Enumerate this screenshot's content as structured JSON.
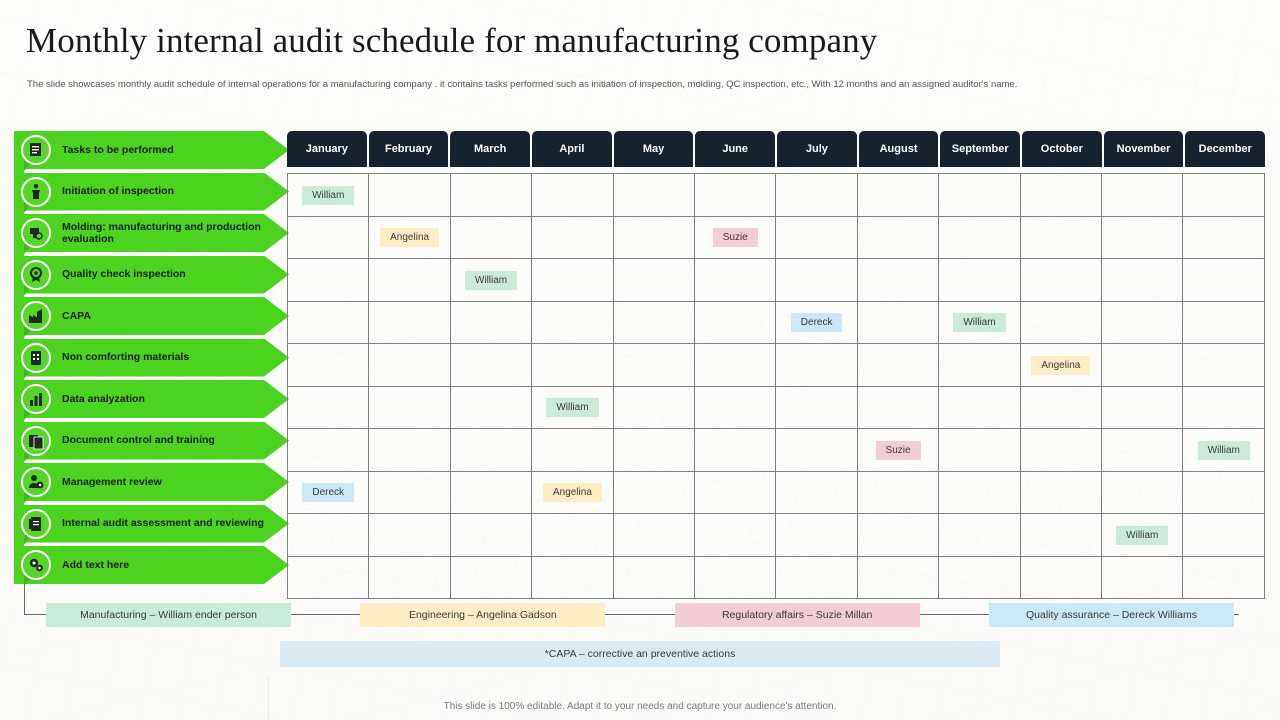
{
  "slide": {
    "title": "Monthly internal audit schedule for manufacturing company",
    "subtitle": "The slide showcases monthly audit schedule of internal operations  for a manufacturing company . it contains tasks performed such as initiation  of inspection, molding,  QC  inspection, etc., With 12 months and an assigned auditor's name.",
    "footnote": "*CAPA – corrective an preventive actions",
    "bottom_note": "This slide is 100% editable.  Adapt it to your needs and capture your audience's attention."
  },
  "colors": {
    "green_arrow": "#4cd320",
    "header_navy": "#16232e",
    "chip_green": "#c9ebd8",
    "chip_cream": "#fdeec6",
    "chip_pink": "#f2cdd3",
    "chip_blue": "#cce8f5",
    "footnote_bar": "#dbeaf2"
  },
  "tasks": [
    {
      "label": "Tasks to be performed",
      "icon": "document-lines-icon"
    },
    {
      "label": "Initiation  of inspection",
      "icon": "presenter-podium-icon"
    },
    {
      "label": "Molding:  manufacturing and production  evaluation",
      "icon": "stamp-press-icon"
    },
    {
      "label": "Quality  check inspection",
      "icon": "quality-badge-icon"
    },
    {
      "label": "CAPA",
      "icon": "factory-icon"
    },
    {
      "label": "Non  comforting materials",
      "icon": "clipboard-box-icon"
    },
    {
      "label": "Data analyzation",
      "icon": "bar-chart-icon"
    },
    {
      "label": "Document control and  training",
      "icon": "document-stack-icon"
    },
    {
      "label": "Management review",
      "icon": "person-gear-icon"
    },
    {
      "label": "Internal audit assessment and  reviewing",
      "icon": "audit-book-icon"
    },
    {
      "label": "Add  text here",
      "icon": "gears-icon"
    }
  ],
  "months": [
    "January",
    "February",
    "March",
    "April",
    "May",
    "June",
    "July",
    "August",
    "September",
    "October",
    "November",
    "December"
  ],
  "schedule": [
    {
      "task": "Initiation  of inspection",
      "cells": [
        {
          "month": "January",
          "name": "William",
          "color": "green"
        }
      ]
    },
    {
      "task": "Molding:  manufacturing and production  evaluation",
      "cells": [
        {
          "month": "February",
          "name": "Angelina",
          "color": "cream"
        },
        {
          "month": "June",
          "name": "Suzie",
          "color": "pink"
        }
      ]
    },
    {
      "task": "Quality  check inspection",
      "cells": [
        {
          "month": "March",
          "name": "William",
          "color": "green"
        }
      ]
    },
    {
      "task": "CAPA",
      "cells": [
        {
          "month": "July",
          "name": "Dereck",
          "color": "blue"
        },
        {
          "month": "September",
          "name": "William",
          "color": "green"
        }
      ]
    },
    {
      "task": "Non  comforting materials",
      "cells": [
        {
          "month": "October",
          "name": "Angelina",
          "color": "cream"
        }
      ]
    },
    {
      "task": "Data analyzation",
      "cells": [
        {
          "month": "April",
          "name": "William",
          "color": "green"
        }
      ]
    },
    {
      "task": "Document control and  training",
      "cells": [
        {
          "month": "August",
          "name": "Suzie",
          "color": "pink"
        },
        {
          "month": "December",
          "name": "William",
          "color": "green"
        }
      ]
    },
    {
      "task": "Management review",
      "cells": [
        {
          "month": "January",
          "name": "Dereck",
          "color": "blue"
        },
        {
          "month": "April",
          "name": "Angelina",
          "color": "cream"
        }
      ]
    },
    {
      "task": "Internal audit assessment and  reviewing",
      "cells": [
        {
          "month": "November",
          "name": "William",
          "color": "green"
        }
      ]
    },
    {
      "task": "Add  text here",
      "cells": []
    }
  ],
  "legend": [
    {
      "label": "Manufacturing – William ender person",
      "color": "green"
    },
    {
      "label": "Engineering – Angelina Gadson",
      "color": "cream"
    },
    {
      "label": "Regulatory affairs – Suzie Millan",
      "color": "pink"
    },
    {
      "label": "Quality assurance – Dereck Williams",
      "color": "blue"
    }
  ]
}
